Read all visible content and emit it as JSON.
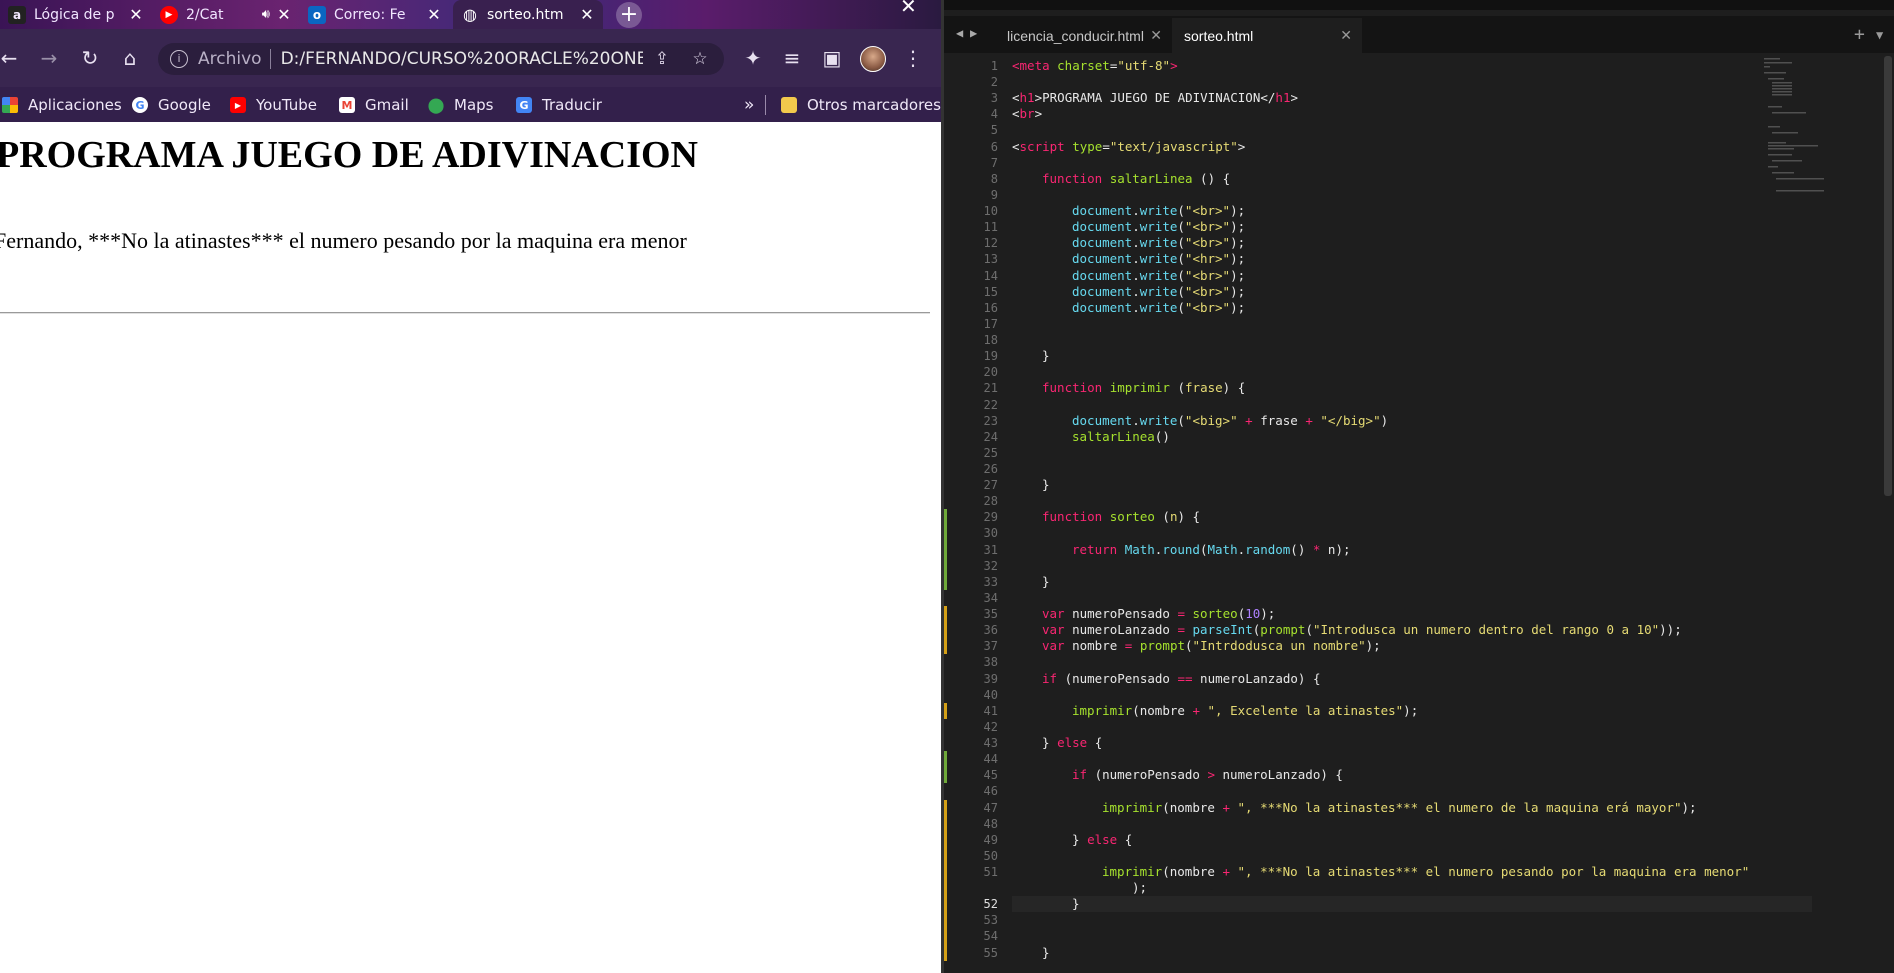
{
  "browser": {
    "tabs": [
      {
        "title": "Lógica de p",
        "favicon": "amazon-icon",
        "favicon_char": "a",
        "favicon_bg": "#222222",
        "active": false
      },
      {
        "title": "2/Cat",
        "favicon": "youtube-icon",
        "favicon_char": "▶",
        "favicon_bg": "#ff0000",
        "active": false,
        "audio": true
      },
      {
        "title": "Correo: Fe",
        "favicon": "outlook-icon",
        "favicon_char": "o",
        "favicon_bg": "#0a66c2",
        "active": false
      },
      {
        "title": "sorteo.htm",
        "favicon": "globe-icon",
        "favicon_char": "◍",
        "favicon_bg": "transparent",
        "active": true
      }
    ],
    "omnibox": {
      "scheme": "Archivo",
      "url": "D:/FERNANDO/CURSO%20ORACLE%20ONE..."
    },
    "bookmarks": [
      {
        "label": "Aplicaciones",
        "icon": "apps-grid-icon"
      },
      {
        "label": "Google",
        "icon": "google-icon"
      },
      {
        "label": "YouTube",
        "icon": "youtube-icon"
      },
      {
        "label": "Gmail",
        "icon": "gmail-icon"
      },
      {
        "label": "Maps",
        "icon": "maps-icon"
      },
      {
        "label": "Traducir",
        "icon": "translate-icon"
      }
    ],
    "bookmarks_overflow": "»",
    "other_bookmarks": "Otros marcadores",
    "page": {
      "heading": "PROGRAMA JUEGO DE ADIVINACION",
      "result": "Fernando, ***No la atinastes*** el numero pesando por la maquina era menor"
    }
  },
  "editor": {
    "tabs": [
      {
        "label": "licencia_conducir.html",
        "active": false
      },
      {
        "label": "sorteo.html",
        "active": true
      }
    ],
    "current_line": 52,
    "colors": {
      "tag": "#f92672",
      "attr": "#a6e22e",
      "string": "#e6db74",
      "keyword": "#f92672",
      "func": "#a6e22e",
      "builtin": "#66d9ef",
      "number": "#ae81ff",
      "plain": "#e8e8e8"
    },
    "gutter_marks": [
      {
        "from": 29,
        "to": 33,
        "color": "#6fa93a"
      },
      {
        "from": 35,
        "to": 37,
        "color": "#d4a017"
      },
      {
        "from": 41,
        "to": 41,
        "color": "#d4a017"
      },
      {
        "from": 44,
        "to": 45,
        "color": "#6fa93a"
      },
      {
        "from": 47,
        "to": 55,
        "color": "#d4a017"
      }
    ],
    "lines": [
      {
        "n": 1,
        "indent": 0,
        "tokens": [
          [
            "tag",
            "<meta "
          ],
          [
            "attr",
            "charset"
          ],
          [
            "plain",
            "="
          ],
          [
            "string",
            "\"utf-8\""
          ],
          [
            "tag",
            ">"
          ]
        ]
      },
      {
        "n": 2,
        "indent": 0,
        "tokens": []
      },
      {
        "n": 3,
        "indent": 0,
        "tokens": [
          [
            "plain",
            "<"
          ],
          [
            "tag",
            "h1"
          ],
          [
            "plain",
            ">PROGRAMA JUEGO DE ADIVINACION</"
          ],
          [
            "tag",
            "h1"
          ],
          [
            "plain",
            ">"
          ]
        ]
      },
      {
        "n": 4,
        "indent": 0,
        "tokens": [
          [
            "plain",
            "<"
          ],
          [
            "tag",
            "br"
          ],
          [
            "plain",
            ">"
          ]
        ]
      },
      {
        "n": 5,
        "indent": 0,
        "tokens": []
      },
      {
        "n": 6,
        "indent": 0,
        "tokens": [
          [
            "plain",
            "<"
          ],
          [
            "tag",
            "script"
          ],
          [
            "plain",
            " "
          ],
          [
            "attr",
            "type"
          ],
          [
            "plain",
            "="
          ],
          [
            "string",
            "\"text/javascript\""
          ],
          [
            "plain",
            ">"
          ]
        ]
      },
      {
        "n": 7,
        "indent": 0,
        "tokens": []
      },
      {
        "n": 8,
        "indent": 1,
        "tokens": [
          [
            "keyword",
            "function "
          ],
          [
            "func",
            "saltarLinea"
          ],
          [
            "plain",
            " () {"
          ]
        ]
      },
      {
        "n": 9,
        "indent": 0,
        "tokens": []
      },
      {
        "n": 10,
        "indent": 2,
        "tokens": [
          [
            "builtin",
            "document"
          ],
          [
            "plain",
            "."
          ],
          [
            "builtin",
            "write"
          ],
          [
            "plain",
            "("
          ],
          [
            "string",
            "\"<br>\""
          ],
          [
            "plain",
            ");"
          ]
        ]
      },
      {
        "n": 11,
        "indent": 2,
        "tokens": [
          [
            "builtin",
            "document"
          ],
          [
            "plain",
            "."
          ],
          [
            "builtin",
            "write"
          ],
          [
            "plain",
            "("
          ],
          [
            "string",
            "\"<br>\""
          ],
          [
            "plain",
            ");"
          ]
        ]
      },
      {
        "n": 12,
        "indent": 2,
        "tokens": [
          [
            "builtin",
            "document"
          ],
          [
            "plain",
            "."
          ],
          [
            "builtin",
            "write"
          ],
          [
            "plain",
            "("
          ],
          [
            "string",
            "\"<br>\""
          ],
          [
            "plain",
            ");"
          ]
        ]
      },
      {
        "n": 13,
        "indent": 2,
        "tokens": [
          [
            "builtin",
            "document"
          ],
          [
            "plain",
            "."
          ],
          [
            "builtin",
            "write"
          ],
          [
            "plain",
            "("
          ],
          [
            "string",
            "\"<hr>\""
          ],
          [
            "plain",
            ");"
          ]
        ]
      },
      {
        "n": 14,
        "indent": 2,
        "tokens": [
          [
            "builtin",
            "document"
          ],
          [
            "plain",
            "."
          ],
          [
            "builtin",
            "write"
          ],
          [
            "plain",
            "("
          ],
          [
            "string",
            "\"<br>\""
          ],
          [
            "plain",
            ");"
          ]
        ]
      },
      {
        "n": 15,
        "indent": 2,
        "tokens": [
          [
            "builtin",
            "document"
          ],
          [
            "plain",
            "."
          ],
          [
            "builtin",
            "write"
          ],
          [
            "plain",
            "("
          ],
          [
            "string",
            "\"<br>\""
          ],
          [
            "plain",
            ");"
          ]
        ]
      },
      {
        "n": 16,
        "indent": 2,
        "tokens": [
          [
            "builtin",
            "document"
          ],
          [
            "plain",
            "."
          ],
          [
            "builtin",
            "write"
          ],
          [
            "plain",
            "("
          ],
          [
            "string",
            "\"<br>\""
          ],
          [
            "plain",
            ");"
          ]
        ]
      },
      {
        "n": 17,
        "indent": 0,
        "tokens": []
      },
      {
        "n": 18,
        "indent": 0,
        "tokens": []
      },
      {
        "n": 19,
        "indent": 1,
        "tokens": [
          [
            "plain",
            "}"
          ]
        ]
      },
      {
        "n": 20,
        "indent": 0,
        "tokens": []
      },
      {
        "n": 21,
        "indent": 1,
        "tokens": [
          [
            "keyword",
            "function "
          ],
          [
            "func",
            "imprimir"
          ],
          [
            "plain",
            " ("
          ],
          [
            "string",
            "frase"
          ],
          [
            "plain",
            ") {"
          ]
        ]
      },
      {
        "n": 22,
        "indent": 0,
        "tokens": []
      },
      {
        "n": 23,
        "indent": 2,
        "tokens": [
          [
            "builtin",
            "document"
          ],
          [
            "plain",
            "."
          ],
          [
            "builtin",
            "write"
          ],
          [
            "plain",
            "("
          ],
          [
            "string",
            "\"<big>\""
          ],
          [
            "keyword",
            " + "
          ],
          [
            "plain",
            "frase"
          ],
          [
            "keyword",
            " + "
          ],
          [
            "string",
            "\"</big>\""
          ],
          [
            "plain",
            ")"
          ]
        ]
      },
      {
        "n": 24,
        "indent": 2,
        "tokens": [
          [
            "func",
            "saltarLinea"
          ],
          [
            "plain",
            "()"
          ]
        ]
      },
      {
        "n": 25,
        "indent": 0,
        "tokens": []
      },
      {
        "n": 26,
        "indent": 0,
        "tokens": []
      },
      {
        "n": 27,
        "indent": 1,
        "tokens": [
          [
            "plain",
            "}"
          ]
        ]
      },
      {
        "n": 28,
        "indent": 0,
        "tokens": []
      },
      {
        "n": 29,
        "indent": 1,
        "tokens": [
          [
            "keyword",
            "function "
          ],
          [
            "func",
            "sorteo"
          ],
          [
            "plain",
            " ("
          ],
          [
            "string",
            "n"
          ],
          [
            "plain",
            ") {"
          ]
        ]
      },
      {
        "n": 30,
        "indent": 0,
        "tokens": []
      },
      {
        "n": 31,
        "indent": 2,
        "tokens": [
          [
            "keyword",
            "return "
          ],
          [
            "builtin",
            "Math"
          ],
          [
            "plain",
            "."
          ],
          [
            "builtin",
            "round"
          ],
          [
            "plain",
            "("
          ],
          [
            "builtin",
            "Math"
          ],
          [
            "plain",
            "."
          ],
          [
            "builtin",
            "random"
          ],
          [
            "plain",
            "() "
          ],
          [
            "keyword",
            "*"
          ],
          [
            "plain",
            " n);"
          ]
        ]
      },
      {
        "n": 32,
        "indent": 0,
        "tokens": []
      },
      {
        "n": 33,
        "indent": 1,
        "tokens": [
          [
            "plain",
            "}"
          ]
        ]
      },
      {
        "n": 34,
        "indent": 0,
        "tokens": []
      },
      {
        "n": 35,
        "indent": 1,
        "tokens": [
          [
            "keyword",
            "var "
          ],
          [
            "plain",
            "numeroPensado "
          ],
          [
            "keyword",
            "="
          ],
          [
            "plain",
            " "
          ],
          [
            "func",
            "sorteo"
          ],
          [
            "plain",
            "("
          ],
          [
            "number",
            "10"
          ],
          [
            "plain",
            ");"
          ]
        ]
      },
      {
        "n": 36,
        "indent": 1,
        "tokens": [
          [
            "keyword",
            "var "
          ],
          [
            "plain",
            "numeroLanzado "
          ],
          [
            "keyword",
            "="
          ],
          [
            "plain",
            " "
          ],
          [
            "builtin",
            "parseInt"
          ],
          [
            "plain",
            "("
          ],
          [
            "func",
            "prompt"
          ],
          [
            "plain",
            "("
          ],
          [
            "string",
            "\"Introdusca un numero dentro del rango 0 a 10\""
          ],
          [
            "plain",
            "));"
          ]
        ]
      },
      {
        "n": 37,
        "indent": 1,
        "tokens": [
          [
            "keyword",
            "var "
          ],
          [
            "plain",
            "nombre "
          ],
          [
            "keyword",
            "="
          ],
          [
            "plain",
            " "
          ],
          [
            "func",
            "prompt"
          ],
          [
            "plain",
            "("
          ],
          [
            "string",
            "\"Intrdodusca un nombre\""
          ],
          [
            "plain",
            ");"
          ]
        ]
      },
      {
        "n": 38,
        "indent": 0,
        "tokens": []
      },
      {
        "n": 39,
        "indent": 1,
        "tokens": [
          [
            "keyword",
            "if "
          ],
          [
            "plain",
            "(numeroPensado "
          ],
          [
            "keyword",
            "=="
          ],
          [
            "plain",
            " numeroLanzado) {"
          ]
        ]
      },
      {
        "n": 40,
        "indent": 0,
        "tokens": []
      },
      {
        "n": 41,
        "indent": 2,
        "tokens": [
          [
            "func",
            "imprimir"
          ],
          [
            "plain",
            "(nombre "
          ],
          [
            "keyword",
            "+"
          ],
          [
            "plain",
            " "
          ],
          [
            "string",
            "\", Excelente la atinastes\""
          ],
          [
            "plain",
            ");"
          ]
        ]
      },
      {
        "n": 42,
        "indent": 0,
        "tokens": []
      },
      {
        "n": 43,
        "indent": 1,
        "tokens": [
          [
            "plain",
            "} "
          ],
          [
            "keyword",
            "else"
          ],
          [
            "plain",
            " {"
          ]
        ]
      },
      {
        "n": 44,
        "indent": 0,
        "tokens": []
      },
      {
        "n": 45,
        "indent": 2,
        "tokens": [
          [
            "keyword",
            "if "
          ],
          [
            "plain",
            "(numeroPensado "
          ],
          [
            "keyword",
            ">"
          ],
          [
            "plain",
            " numeroLanzado) {"
          ]
        ]
      },
      {
        "n": 46,
        "indent": 0,
        "tokens": []
      },
      {
        "n": 47,
        "indent": 3,
        "tokens": [
          [
            "func",
            "imprimir"
          ],
          [
            "plain",
            "(nombre "
          ],
          [
            "keyword",
            "+"
          ],
          [
            "plain",
            " "
          ],
          [
            "string",
            "\", ***No la atinastes*** el numero de la maquina erá mayor\""
          ],
          [
            "plain",
            ");"
          ]
        ]
      },
      {
        "n": 48,
        "indent": 0,
        "tokens": []
      },
      {
        "n": 49,
        "indent": 2,
        "tokens": [
          [
            "plain",
            "} "
          ],
          [
            "keyword",
            "else"
          ],
          [
            "plain",
            " {"
          ]
        ]
      },
      {
        "n": 50,
        "indent": 0,
        "tokens": []
      },
      {
        "n": 51,
        "indent": 3,
        "tokens": [
          [
            "func",
            "imprimir"
          ],
          [
            "plain",
            "(nombre "
          ],
          [
            "keyword",
            "+"
          ],
          [
            "plain",
            " "
          ],
          [
            "string",
            "\", ***No la atinastes*** el numero pesando por la maquina era menor\""
          ]
        ]
      },
      {
        "n": 51,
        "indent": 4,
        "wrap": true,
        "tokens": [
          [
            "plain",
            ");"
          ]
        ]
      },
      {
        "n": 52,
        "indent": 2,
        "tokens": [
          [
            "plain",
            "}"
          ]
        ]
      },
      {
        "n": 53,
        "indent": 0,
        "tokens": []
      },
      {
        "n": 54,
        "indent": 0,
        "tokens": []
      },
      {
        "n": 55,
        "indent": 1,
        "tokens": [
          [
            "plain",
            "}"
          ]
        ]
      }
    ]
  }
}
